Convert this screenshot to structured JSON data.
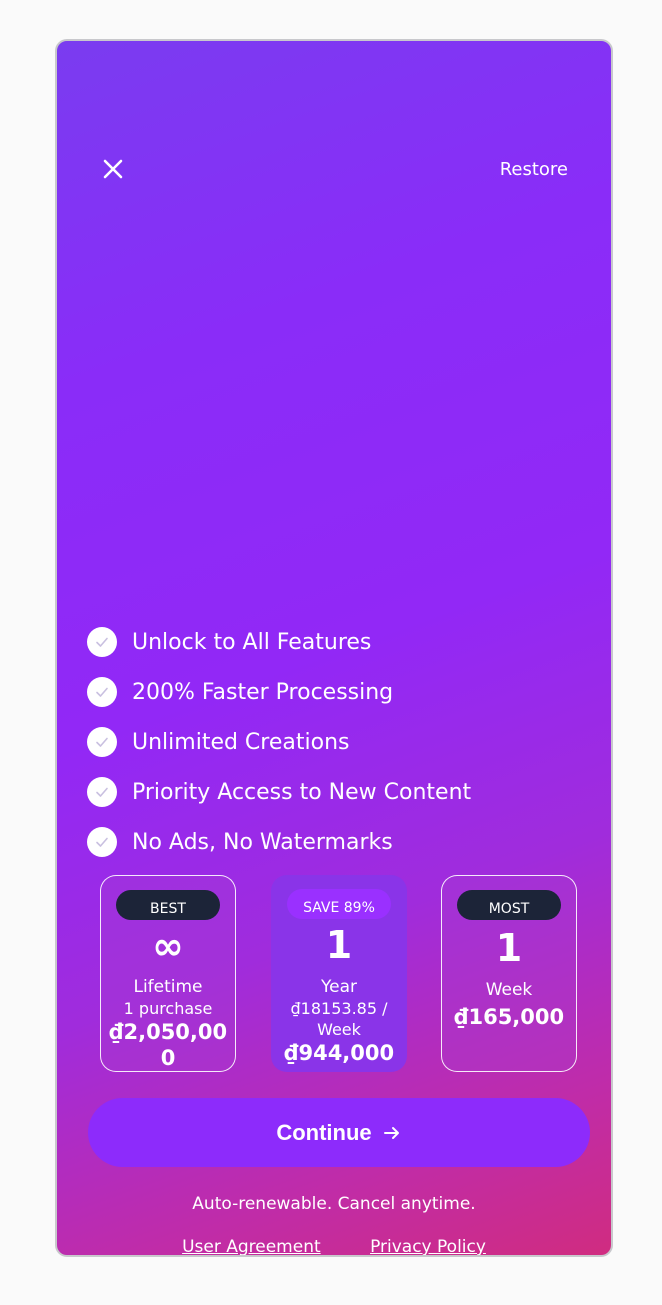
{
  "header": {
    "restore_label": "Restore",
    "close_icon": "close-icon"
  },
  "features": [
    {
      "label": "Unlock to All Features",
      "icon": "check-icon"
    },
    {
      "label": "200% Faster Processing",
      "icon": "check-icon"
    },
    {
      "label": "Unlimited Creations",
      "icon": "check-icon"
    },
    {
      "label": "Priority Access to New Content",
      "icon": "check-icon"
    },
    {
      "label": "No Ads, No Watermarks",
      "icon": "check-icon"
    }
  ],
  "plans": [
    {
      "badge": "BEST",
      "big": "∞",
      "unit": "Lifetime",
      "sub": "1 purchase",
      "price": "₫2,050,000",
      "selected": false
    },
    {
      "badge": "SAVE 89%",
      "big": "1",
      "unit": "Year",
      "sub": "₫18153.85 / Week",
      "price": "₫944,000",
      "selected": true
    },
    {
      "badge": "MOST",
      "big": "1",
      "unit": "Week",
      "sub": "",
      "price": "₫165,000",
      "selected": false
    }
  ],
  "cta": {
    "label": "Continue",
    "icon": "arrow-right-icon"
  },
  "footer": {
    "renew_text": "Auto-renewable. Cancel anytime.",
    "user_agreement": "User Agreement",
    "privacy_policy": "Privacy Policy"
  },
  "colors": {
    "accent": "#8d2bfb",
    "badge_dark": "#1c2438"
  }
}
